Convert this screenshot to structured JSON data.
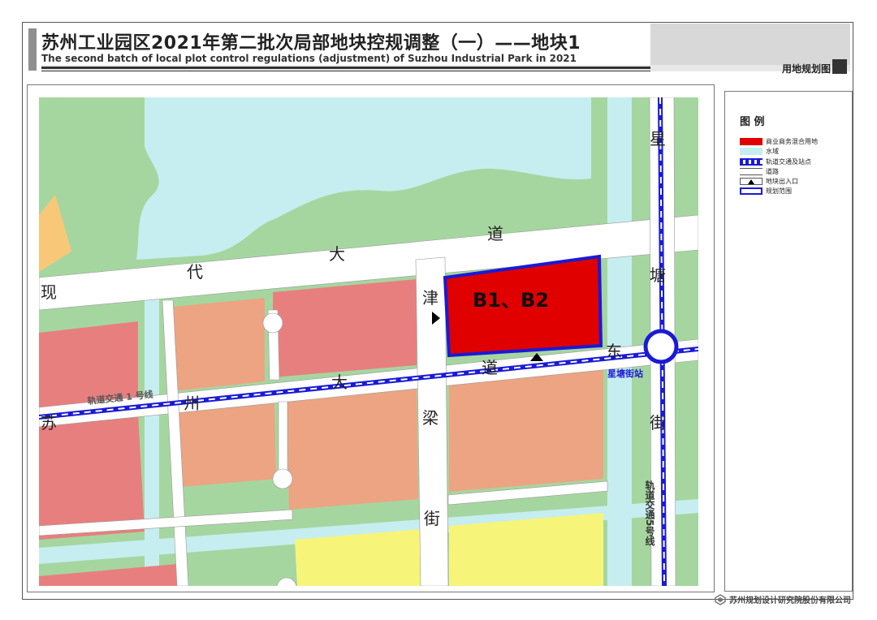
{
  "header": {
    "title_cn": "苏州工业园区2021年第二批次局部地块控规调整（一）——地块1",
    "title_en": "The second batch of local plot control regulations (adjustment) of Suzhou Industrial Park in 2021",
    "sheet_name": "用地规划图"
  },
  "map": {
    "plot_label": "B1、B2",
    "road_chars": {
      "xiandai_1": "现",
      "xiandai_2": "代",
      "xiandai_3": "大",
      "xiandai_4": "道",
      "suzhou_1": "苏",
      "suzhou_2": "州",
      "suzhou_3": "大",
      "suzhou_4": "道",
      "suzhou_5": "东",
      "jinliang_1": "津",
      "jinliang_2": "梁",
      "jinliang_3": "街",
      "xingtang_1": "星",
      "xingtang_2": "塘",
      "xingtang_3": "街"
    },
    "rail_line_1": "轨道交通 1 号线",
    "rail_line_5": "轨道交通5号线",
    "station": "星塘街站"
  },
  "legend": {
    "title": "图 例",
    "items": [
      {
        "label": "商业商务混合用地",
        "color": "#e00000"
      },
      {
        "label": "水域",
        "color": "#c6eef0"
      },
      {
        "label": "轨道交通及站点",
        "color": "#1a1ad6"
      },
      {
        "label": "道路",
        "color": "#ffffff"
      },
      {
        "label": "地块出入口",
        "color": "#000000"
      },
      {
        "label": "规划范围",
        "color": "#1a1ad6"
      }
    ]
  },
  "footer": {
    "company": "苏州规划设计研究院股份有限公司"
  },
  "colors": {
    "green": "#a6d6a0",
    "water": "#c6eef0",
    "commercial": "#e00000",
    "pink": "#e87f7f",
    "salmon": "#eca482",
    "yellow": "#f7f47a",
    "orange": "#f8c878",
    "rail": "#1a1ad6"
  }
}
